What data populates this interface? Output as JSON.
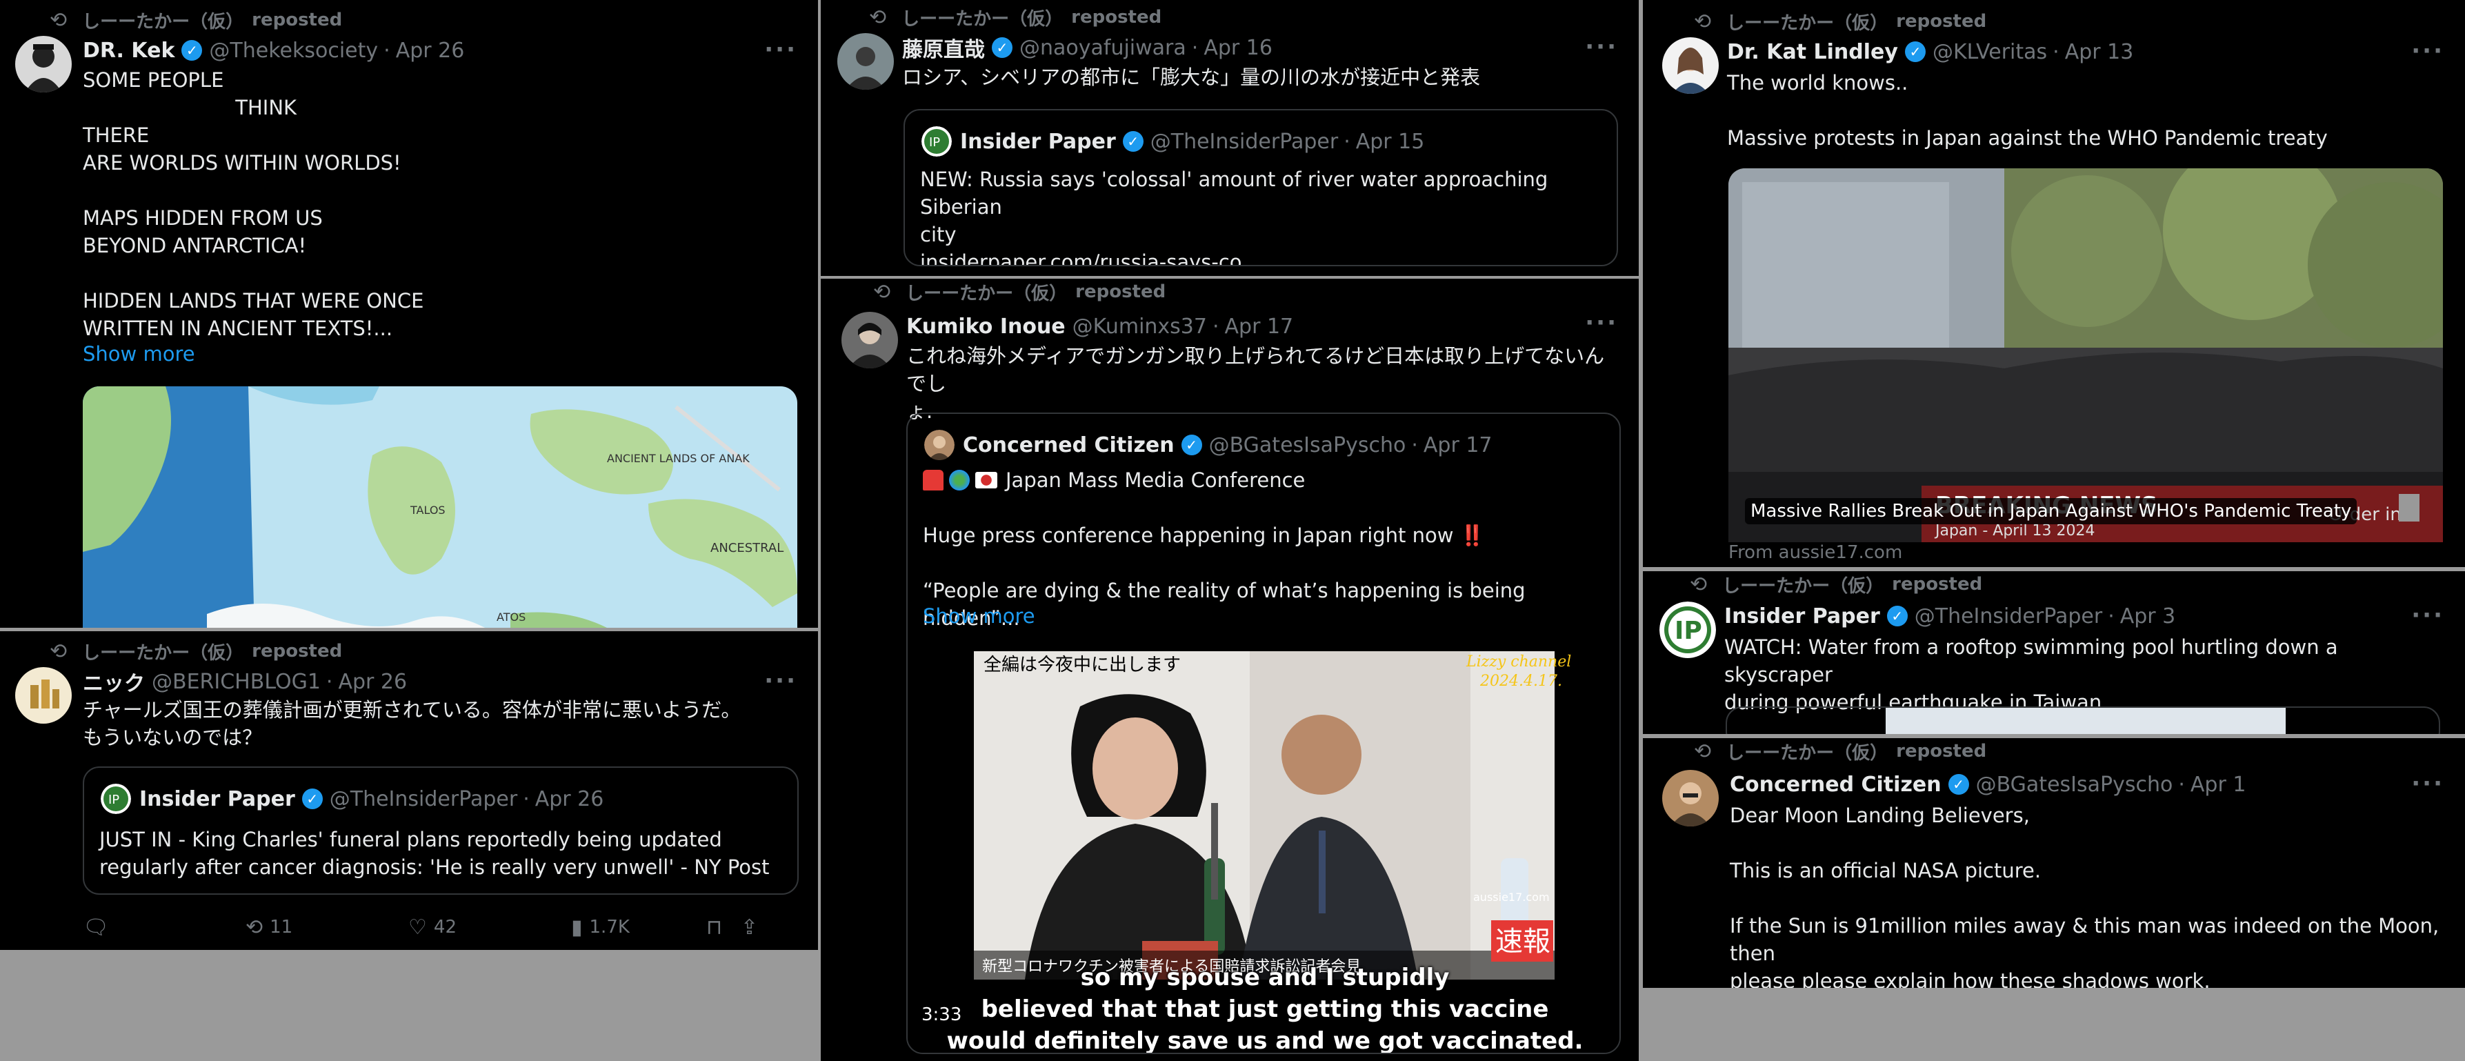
{
  "repost_user": "しーーたかー（仮）",
  "repost_label": "reposted",
  "tweets": {
    "kek": {
      "name": "DR. Kek",
      "handle": "@Thekeksociety",
      "date": "Apr 26",
      "text": "SOME PEOPLE\n                        THINK\nTHERE\nARE WORLDS WITHIN WORLDS!\n\nMAPS HIDDEN FROM US\nBEYOND ANTARCTICA!\n\nHIDDEN LANDS THAT WERE ONCE\nWRITTEN IN ANCIENT TEXTS!...",
      "show_more": "Show more",
      "map_labels": [
        "ANCIENT LANDS OF ANAK",
        "TALOS",
        "ANCESTRAL",
        "ATOS"
      ]
    },
    "nick": {
      "name": "ニック",
      "handle": "@BERICHBLOG1",
      "date": "Apr 26",
      "text": "チャールズ国王の葬儀計画が更新されている。容体が非常に悪いようだ。\nもういないのでは？",
      "quote": {
        "name": "Insider Paper",
        "handle": "@TheInsiderPaper",
        "date": "Apr 26",
        "text": "JUST IN - King Charles' funeral plans reportedly being updated\nregularly after cancer diagnosis: 'He is really very unwell' - NY Post"
      },
      "stats": {
        "replies": "",
        "reposts": "11",
        "likes": "42",
        "views": "1.7K"
      }
    },
    "fujiwara": {
      "name": "藤原直哉",
      "handle": "@naoyafujiwara",
      "date": "Apr 16",
      "text": "ロシア、シベリアの都市に「膨大な」量の川の水が接近中と発表",
      "quote": {
        "name": "Insider Paper",
        "handle": "@TheInsiderPaper",
        "date": "Apr 15",
        "text": "NEW: Russia says 'colossal' amount of river water approaching Siberian\ncity\ninsiderpaper.com/russia-says-co..."
      }
    },
    "kumiko": {
      "name": "Kumiko Inoue",
      "handle": "@Kuminxs37",
      "date": "Apr 17",
      "text": "これね海外メディアでガンガン取り上げられてるけど日本は取り上げてないんでし\nょ.",
      "quote": {
        "name": "Concerned Citizen",
        "handle": "@BGatesIsaPyscho",
        "date": "Apr 17",
        "emoji_line": "Japan Mass Media Conference",
        "text": "Huge press conference happening in Japan right now ‼️\n\n“People are dying & the reality of what’s happening is being hidden”...",
        "show_more": "Show more",
        "video": {
          "top_left": "全編は今夜中に出します",
          "channel": "Lizzy channel",
          "vdate": "2024.4.17.",
          "watermark": "aussie17.com",
          "bottom_jp": "新型コロナワクチン被害者による国賠請求訴訟記者会見",
          "badge": "速報",
          "subtitle": "so my spouse and I stupidly\nbelieved that that just getting this vaccine\nwould definitely save us and we got vaccinated.",
          "duration": "3:33"
        }
      }
    },
    "kat": {
      "name": "Dr. Kat Lindley",
      "handle": "@KLVeritas",
      "date": "Apr 13",
      "text": "The world knows..\n\nMassive protests in Japan against the WHO Pandemic treaty",
      "card_title": "Massive Rallies Break Out in Japan Against WHO's Pandemic Treaty",
      "card_overlay": "BREAKING NEWS",
      "card_overlay2": "Japan - April 13 2024",
      "card_overlay3": "Order in",
      "card_source": "From aussie17.com"
    },
    "insider": {
      "name": "Insider Paper",
      "handle": "@TheInsiderPaper",
      "date": "Apr 3",
      "text": "WATCH: Water from a rooftop swimming pool hurtling down a skyscraper\nduring powerful earthquake in Taiwan"
    },
    "citizen": {
      "name": "Concerned Citizen",
      "handle": "@BGatesIsaPyscho",
      "date": "Apr 1",
      "text": "Dear Moon Landing Believers,\n\nThis is an official NASA picture.\n\nIf the Sun is 91million miles away & this man was indeed on the Moon, then\nplease please explain how these shadows work."
    }
  },
  "colors": {
    "background": "#000000",
    "text": "#e7e9ea",
    "muted": "#71767b",
    "accent": "#1d9bf0",
    "border": "#333639",
    "page_gutter": "#9a9a9a"
  }
}
